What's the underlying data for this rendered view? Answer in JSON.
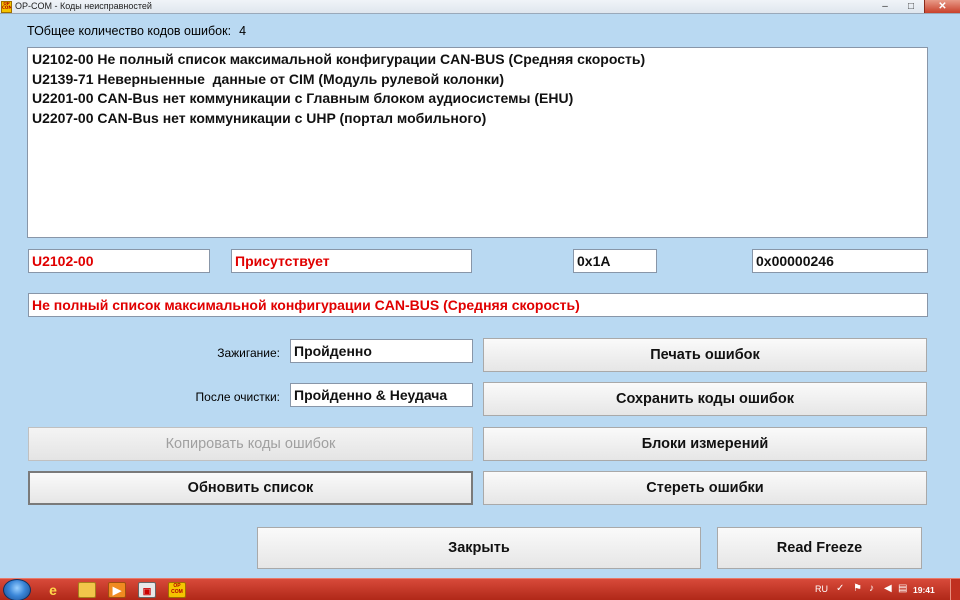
{
  "window": {
    "title": "OP-COM - Коды неисправностей",
    "app_icon_text": "OP COM",
    "minimize": "–",
    "maximize": "□",
    "close": "✕"
  },
  "summary": {
    "count_label": "ТОбщее количество кодов ошибок:",
    "count_value": "4"
  },
  "codes": [
    "U2102-00 Не полный список максимальной конфигурации CAN-BUS (Средняя скорость)",
    "U2139-71 Неверныенные  данные от CIM (Модуль рулевой колонки)",
    "U2201-00 CAN-Bus нет коммуникации с Главным блоком аудиосистемы (EHU)",
    "U2207-00 CAN-Bus нет коммуникации с UHP (портал мобильного)"
  ],
  "selected": {
    "code": "U2102-00",
    "status": "Присутствует",
    "hex_short": "0x1A",
    "hex_long": "0x00000246",
    "description": "Не полный список максимальной конфигурации CAN-BUS (Средняя скорость)"
  },
  "ignition": {
    "label": "Зажигание:",
    "value": "Пройденно"
  },
  "after_clear": {
    "label": "После очистки:",
    "value": "Пройденно & Неудача"
  },
  "buttons": {
    "print": "Печать ошибок",
    "save": "Сохранить коды ошибок",
    "copy": "Копировать коды ошибок",
    "blocks": "Блоки измерений",
    "refresh": "Обновить список",
    "erase": "Стереть ошибки",
    "close": "Закрыть",
    "freeze": "Read Freeze"
  },
  "taskbar": {
    "lang": "RU",
    "clock": "19:41",
    "icons": [
      "start-orb",
      "ie-icon",
      "folder-icon",
      "media-player-icon",
      "app-icon",
      "opcom-icon"
    ],
    "tray_icons": [
      "network-icon",
      "flag-icon",
      "speaker-icon",
      "keyboard-icon"
    ]
  },
  "colors": {
    "background": "#b9d9f2",
    "error_text": "#e00000",
    "taskbar": "#c83020"
  }
}
